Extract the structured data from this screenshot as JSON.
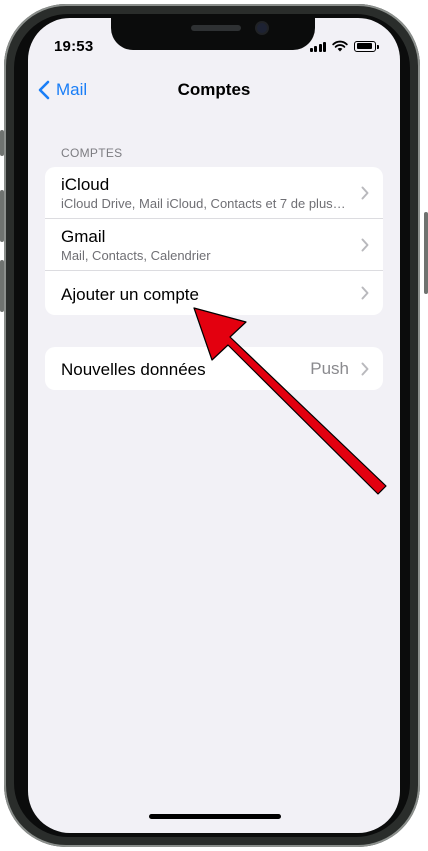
{
  "status_bar": {
    "time": "19:53"
  },
  "nav": {
    "back_label": "Mail",
    "title": "Comptes"
  },
  "accounts_section": {
    "header": "COMPTES",
    "items": [
      {
        "title": "iCloud",
        "subtitle": "iCloud Drive, Mail iCloud, Contacts et 7 de plus…"
      },
      {
        "title": "Gmail",
        "subtitle": "Mail, Contacts, Calendrier"
      },
      {
        "title": "Ajouter un compte"
      }
    ]
  },
  "fetch_section": {
    "title": "Nouvelles données",
    "value": "Push"
  },
  "colors": {
    "accent": "#1a7ef7",
    "background": "#f2f1f6",
    "annotation_arrow": "#e3000f"
  }
}
